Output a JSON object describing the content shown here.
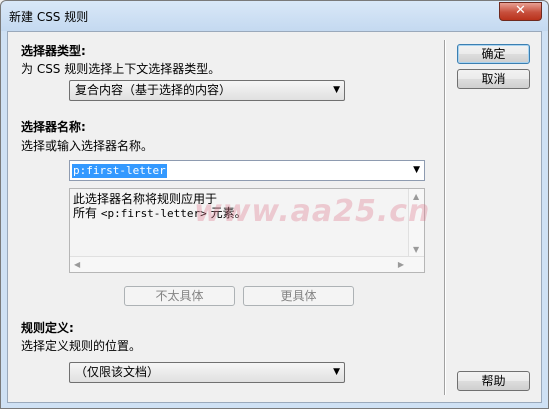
{
  "window": {
    "title": "新建 CSS 规则",
    "close_glyph": "✕"
  },
  "selector_type": {
    "heading": "选择器类型:",
    "description": "为 CSS 规则选择上下文选择器类型。",
    "selected": "复合内容（基于选择的内容）"
  },
  "selector_name": {
    "heading": "选择器名称:",
    "description": "选择或输入选择器名称。",
    "value": "p:first-letter",
    "preview_line1": "此选择器名称将规则应用于",
    "preview_line2_prefix": "所有 ",
    "preview_line2_code": "<p:first-letter>",
    "preview_line2_suffix": " 元素。"
  },
  "specificity": {
    "less_label": "不太具体",
    "more_label": "更具体"
  },
  "rule_definition": {
    "heading": "规则定义:",
    "description": "选择定义规则的位置。",
    "selected": "（仅限该文档）"
  },
  "buttons": {
    "ok": "确定",
    "cancel": "取消",
    "help": "帮助"
  },
  "watermark": "www.aa25.cn",
  "icons": {
    "dropdown": "chevron-down-icon",
    "close": "close-icon"
  }
}
